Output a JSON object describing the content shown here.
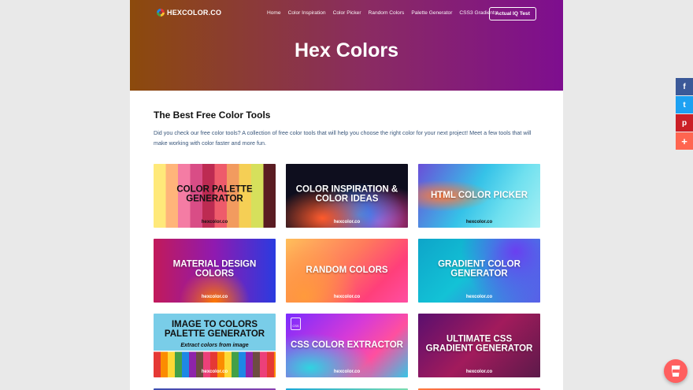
{
  "header": {
    "logo_text": "HEXCOLOR.CO",
    "nav": [
      "Home",
      "Color Inspiration",
      "Color Picker",
      "Random Colors",
      "Palette Generator",
      "CSS3 Gradients"
    ],
    "cta_label": "Actual IQ Test",
    "page_title": "Hex Colors"
  },
  "main": {
    "section_title": "The Best Free Color Tools",
    "intro": "Did you check our free color tools? A collection of free color tools that will help you choose the right color for your next project! Meet a few tools that will make working with color faster and more fun.",
    "cards": [
      {
        "title": "COLOR PALETTE GENERATOR",
        "footer": "hexcolor.co"
      },
      {
        "title": "COLOR INSPIRATION & COLOR IDEAS",
        "footer": "hexcolor.co"
      },
      {
        "title": "HTML COLOR PICKER",
        "footer": "hexcolor.co"
      },
      {
        "title": "MATERIAL DESIGN COLORS",
        "footer": "hexcolor.co"
      },
      {
        "title": "RANDOM COLORS",
        "footer": "hexcolor.co"
      },
      {
        "title": "GRADIENT COLOR GENERATOR",
        "footer": "hexcolor.co"
      },
      {
        "title": "IMAGE TO COLORS PALETTE GENERATOR",
        "subtitle": "Extract colors from image",
        "footer": "hexcolor.co"
      },
      {
        "title": "CSS COLOR EXTRACTOR",
        "footer": "hexcolor.co"
      },
      {
        "title": "ULTIMATE CSS GRADIENT GENERATOR",
        "footer": "hexcolor.co"
      }
    ],
    "css_badge": "CSS"
  },
  "share": {
    "facebook": "f",
    "twitter": "t",
    "pinterest": "p",
    "more": "+"
  },
  "colors": {
    "hero_start": "#8c4a0c",
    "hero_end": "#7e0e8f",
    "intro_text": "#38557a",
    "facebook": "#3b5998",
    "twitter": "#1da1f2",
    "pinterest": "#cb2027",
    "share_more": "#ff6550",
    "coffee_button": "#ff5f5f"
  },
  "icons": [
    "hexcolor-logo-icon",
    "facebook-icon",
    "twitter-icon",
    "pinterest-icon",
    "plus-icon",
    "coffee-cup-icon",
    "css-file-icon"
  ]
}
